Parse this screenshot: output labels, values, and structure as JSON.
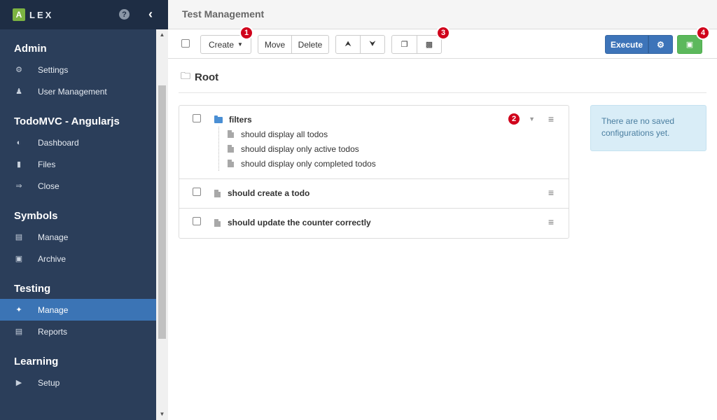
{
  "app": {
    "logo_letter": "A",
    "logo_text": "LEX"
  },
  "sidebar": {
    "sections": [
      {
        "title": "Admin",
        "items": [
          {
            "label": "Settings",
            "icon": "cogs-icon"
          },
          {
            "label": "User Management",
            "icon": "users-icon"
          }
        ]
      },
      {
        "title": "TodoMVC - Angularjs",
        "items": [
          {
            "label": "Dashboard",
            "icon": "dashboard-icon"
          },
          {
            "label": "Files",
            "icon": "file-icon"
          },
          {
            "label": "Close",
            "icon": "sign-out-icon"
          }
        ]
      },
      {
        "title": "Symbols",
        "items": [
          {
            "label": "Manage",
            "icon": "list-icon"
          },
          {
            "label": "Archive",
            "icon": "archive-icon"
          }
        ]
      },
      {
        "title": "Testing",
        "items": [
          {
            "label": "Manage",
            "icon": "wrench-icon",
            "active": true
          },
          {
            "label": "Reports",
            "icon": "list-icon"
          }
        ]
      },
      {
        "title": "Learning",
        "items": [
          {
            "label": "Setup",
            "icon": "play-icon"
          }
        ]
      }
    ]
  },
  "header": {
    "title": "Test Management"
  },
  "toolbar": {
    "create_label": "Create",
    "move_label": "Move",
    "delete_label": "Delete",
    "execute_label": "Execute",
    "badges": [
      "1",
      "2",
      "3",
      "4"
    ]
  },
  "content": {
    "root_label": "Root",
    "rows": [
      {
        "title": "filters",
        "type": "folder",
        "children": [
          "should display all todos",
          "should display only active todos",
          "should display only completed todos"
        ]
      },
      {
        "title": "should create a todo",
        "type": "test"
      },
      {
        "title": "should update the counter correctly",
        "type": "test"
      }
    ],
    "info_message": "There are no saved configurations yet."
  },
  "colors": {
    "sidebar_bg": "#2b3e5a",
    "active_item": "#3b74b5",
    "execute": "#3d74b9",
    "save": "#5cb85c",
    "badge": "#d0021b"
  }
}
